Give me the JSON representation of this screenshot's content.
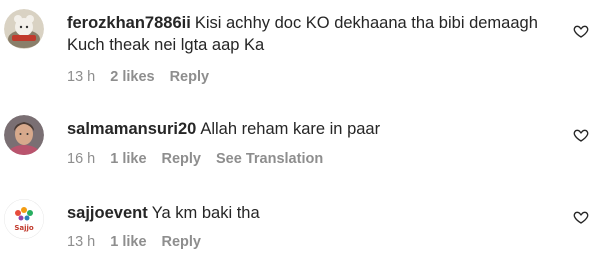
{
  "comments": [
    {
      "username": "ferozkhan7886ii",
      "text": "Kisi achhy doc KO dekhaana tha bibi demaagh Kuch theak nei lgta aap Ka",
      "time": "13 h",
      "likes": "2 likes",
      "reply": "Reply",
      "translation": ""
    },
    {
      "username": "salmamansuri20",
      "text": "Allah reham kare in paar",
      "time": "16 h",
      "likes": "1 like",
      "reply": "Reply",
      "translation": "See Translation"
    },
    {
      "username": "sajjoevent",
      "text": "Ya km baki tha",
      "time": "13 h",
      "likes": "1 like",
      "reply": "Reply",
      "translation": ""
    }
  ],
  "avatar_logo_text": "Sajjo",
  "icons": {
    "like": "heart-outline-icon"
  },
  "colors": {
    "text": "#262626",
    "secondary": "#8e8e8e"
  }
}
